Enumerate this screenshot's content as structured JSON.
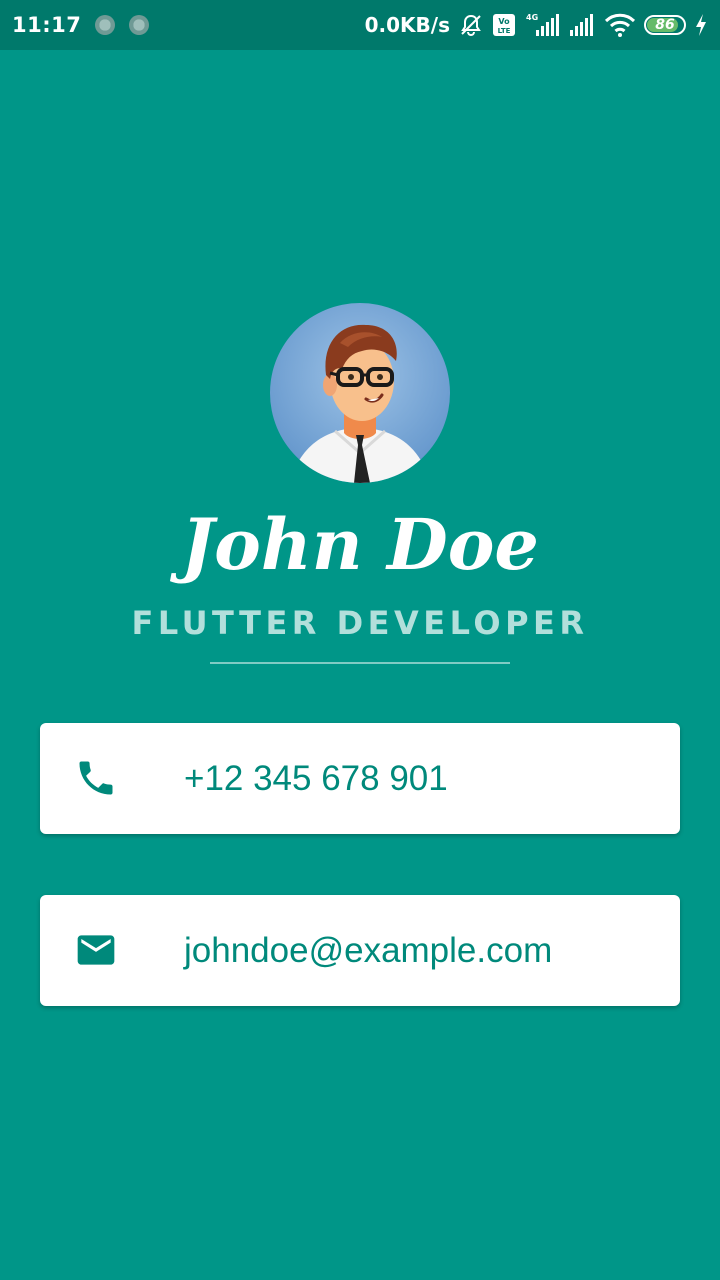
{
  "status_bar": {
    "time": "11:17",
    "net_speed": "0.0KB/s",
    "network_label": "4G",
    "volte_label": "Vo LTE",
    "battery_level": "86",
    "icons": [
      "notification-dot-icon",
      "notification-dot-icon",
      "mute-icon",
      "volte-icon",
      "signal-icon",
      "signal-icon",
      "wifi-icon",
      "battery-icon",
      "charging-icon"
    ]
  },
  "profile": {
    "name": "John Doe",
    "title": "FLUTTER DEVELOPER"
  },
  "contacts": {
    "phone": {
      "icon": "phone-icon",
      "value": "+12 345 678 901"
    },
    "email": {
      "icon": "mail-icon",
      "value": "johndoe@example.com"
    }
  },
  "colors": {
    "background": "#009688",
    "status_bar": "#00796B",
    "card": "#ffffff",
    "accent_text": "#00897B",
    "subtitle": "#B2DFDB"
  }
}
